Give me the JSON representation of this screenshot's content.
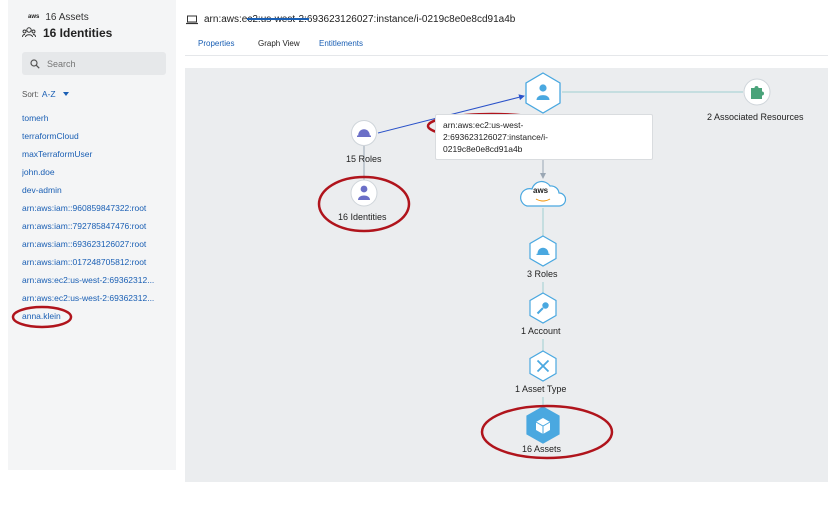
{
  "sidebar": {
    "cut_title": "16 Assets",
    "cut_title_badge": "aws",
    "title": "16 Identities",
    "search": {
      "placeholder": "Search",
      "value": ""
    },
    "sort": {
      "label": "Sort:",
      "value": "A-Z"
    },
    "identities": [
      "tomerh",
      "terraformCloud",
      "maxTerraformUser",
      "john.doe",
      "dev-admin",
      "arn:aws:iam::960859847322:root",
      "arn:aws:iam::792785847476:root",
      "arn:aws:iam::693623126027:root",
      "arn:aws:iam::017248705812:root",
      "arn:aws:ec2:us-west-2:69362312...",
      "arn:aws:ec2:us-west-2:69362312...",
      "anna.klein"
    ]
  },
  "header": {
    "arn": "arn:aws:ec2:us-west-2:693623126027:instance/i-0219c8e0e8cd91a4b",
    "tabs": [
      {
        "label": "Properties",
        "active": false
      },
      {
        "label": "Graph View",
        "active": true
      },
      {
        "label": "Entitlements",
        "active": false
      }
    ]
  },
  "graph": {
    "instance_card": {
      "line1": "arn:aws:ec2:us-west-",
      "line2": "2:693623126027:instance/i-",
      "line3": "0219c8e0e8cd91a4b"
    },
    "resources_label": "2 Associated Resources",
    "roles_left_label": "15 Roles",
    "identities_label": "16 Identities",
    "aws_label": "aws",
    "roles_label": "3 Roles",
    "account_label": "1 Account",
    "asset_type_label": "1 Asset Type",
    "assets_label": "16 Assets"
  },
  "colors": {
    "accent": "#1a5fb4",
    "node_blue": "#4aa8e0",
    "annotation_red": "#b0141c",
    "edge_teal": "#9fcfd0",
    "resource_green": "#4aa37a",
    "roles_purple": "#6b6fc7"
  }
}
